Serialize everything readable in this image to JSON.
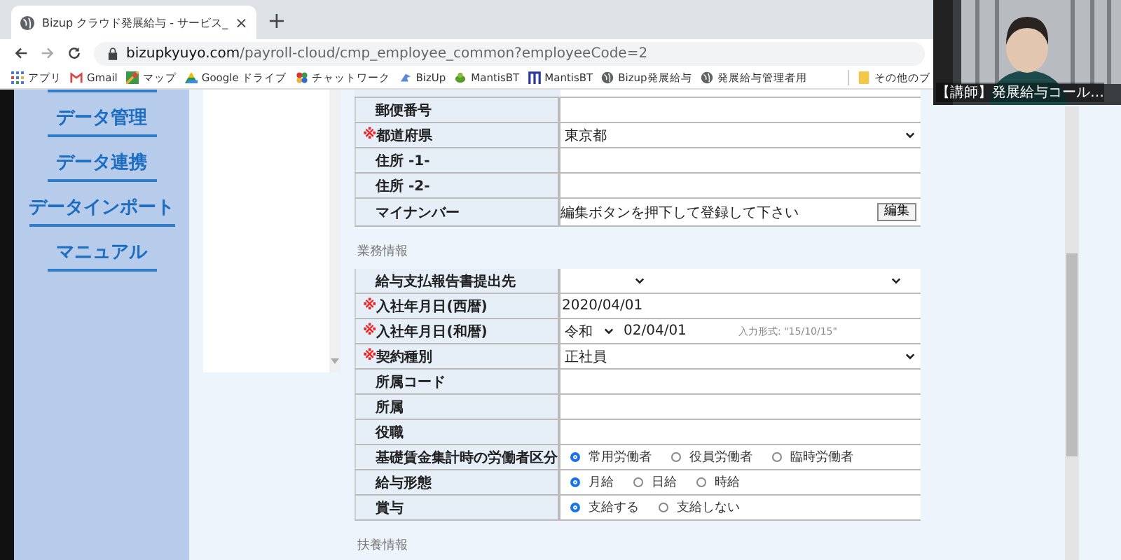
{
  "browser": {
    "tab": {
      "title": "Bizup クラウド発展給与 - サービス_",
      "close": "×"
    },
    "new_tab": "+",
    "url": {
      "host": "bizupkyuyo.com",
      "path": "/payroll-cloud/cmp_employee_common?employeeCode=2"
    },
    "bookmarks": [
      {
        "label": "アプリ",
        "kind": "apps"
      },
      {
        "label": "Gmail",
        "kind": "mail"
      },
      {
        "label": "マップ",
        "kind": "map"
      },
      {
        "label": "Google ドライブ",
        "kind": "drive"
      },
      {
        "label": "チャットワーク",
        "kind": "flower"
      },
      {
        "label": "BizUp",
        "kind": "bird"
      },
      {
        "label": "MantisBT",
        "kind": "mantis"
      },
      {
        "label": "MantisBT",
        "kind": "m"
      },
      {
        "label": "Bizup発展給与",
        "kind": "globe"
      },
      {
        "label": "発展給与管理者用",
        "kind": "globe"
      },
      {
        "label": "その他のブ",
        "kind": "folder"
      }
    ]
  },
  "sidebar": {
    "menu": [
      {
        "label": "データ管理"
      },
      {
        "label": "データ連携"
      },
      {
        "label": "データインポート"
      },
      {
        "label": "マニュアル"
      }
    ]
  },
  "form": {
    "sections": [
      {
        "rows": [
          {
            "label": "郵便番号",
            "required": false,
            "kind": "text"
          },
          {
            "label": "都道府県",
            "required": true,
            "kind": "select",
            "value": "東京都"
          },
          {
            "label": "住所 -1-",
            "required": false,
            "kind": "text"
          },
          {
            "label": "住所 -2-",
            "required": false,
            "kind": "text"
          },
          {
            "label": "マイナンバー",
            "required": false,
            "kind": "mynumber",
            "note": "編集ボタンを押下して登録して下さい",
            "button": "編集"
          }
        ]
      },
      {
        "title": "業務情報",
        "rows": [
          {
            "label": "給与支払報告書提出先",
            "required": false,
            "kind": "select-pair"
          },
          {
            "label": "入社年月日(西暦)",
            "required": true,
            "kind": "date",
            "value": "2020/04/01"
          },
          {
            "label": "入社年月日(和暦)",
            "required": true,
            "kind": "wareki",
            "era": "令和",
            "value": "02/04/01",
            "hint": "入力形式: \"15/10/15\""
          },
          {
            "label": "契約種別",
            "required": true,
            "kind": "select",
            "value": "正社員"
          },
          {
            "label": "所属コード",
            "required": false,
            "kind": "text"
          },
          {
            "label": "所属",
            "required": false,
            "kind": "text"
          },
          {
            "label": "役職",
            "required": false,
            "kind": "text"
          },
          {
            "label": "基礎賃金集計時の労働者区分",
            "required": false,
            "kind": "radio",
            "options": [
              {
                "label": "常用労働者",
                "selected": true
              },
              {
                "label": "役員労働者",
                "selected": false
              },
              {
                "label": "臨時労働者",
                "selected": false
              }
            ]
          },
          {
            "label": "給与形態",
            "required": false,
            "kind": "radio",
            "options": [
              {
                "label": "月給",
                "selected": true
              },
              {
                "label": "日給",
                "selected": false
              },
              {
                "label": "時給",
                "selected": false
              }
            ]
          },
          {
            "label": "賞与",
            "required": false,
            "kind": "radio",
            "options": [
              {
                "label": "支給する",
                "selected": true
              },
              {
                "label": "支給しない",
                "selected": false
              }
            ]
          }
        ]
      },
      {
        "title": "扶養情報"
      }
    ],
    "required_mark": "※"
  },
  "video_call": {
    "caption": "【講師】発展給与コール…"
  }
}
